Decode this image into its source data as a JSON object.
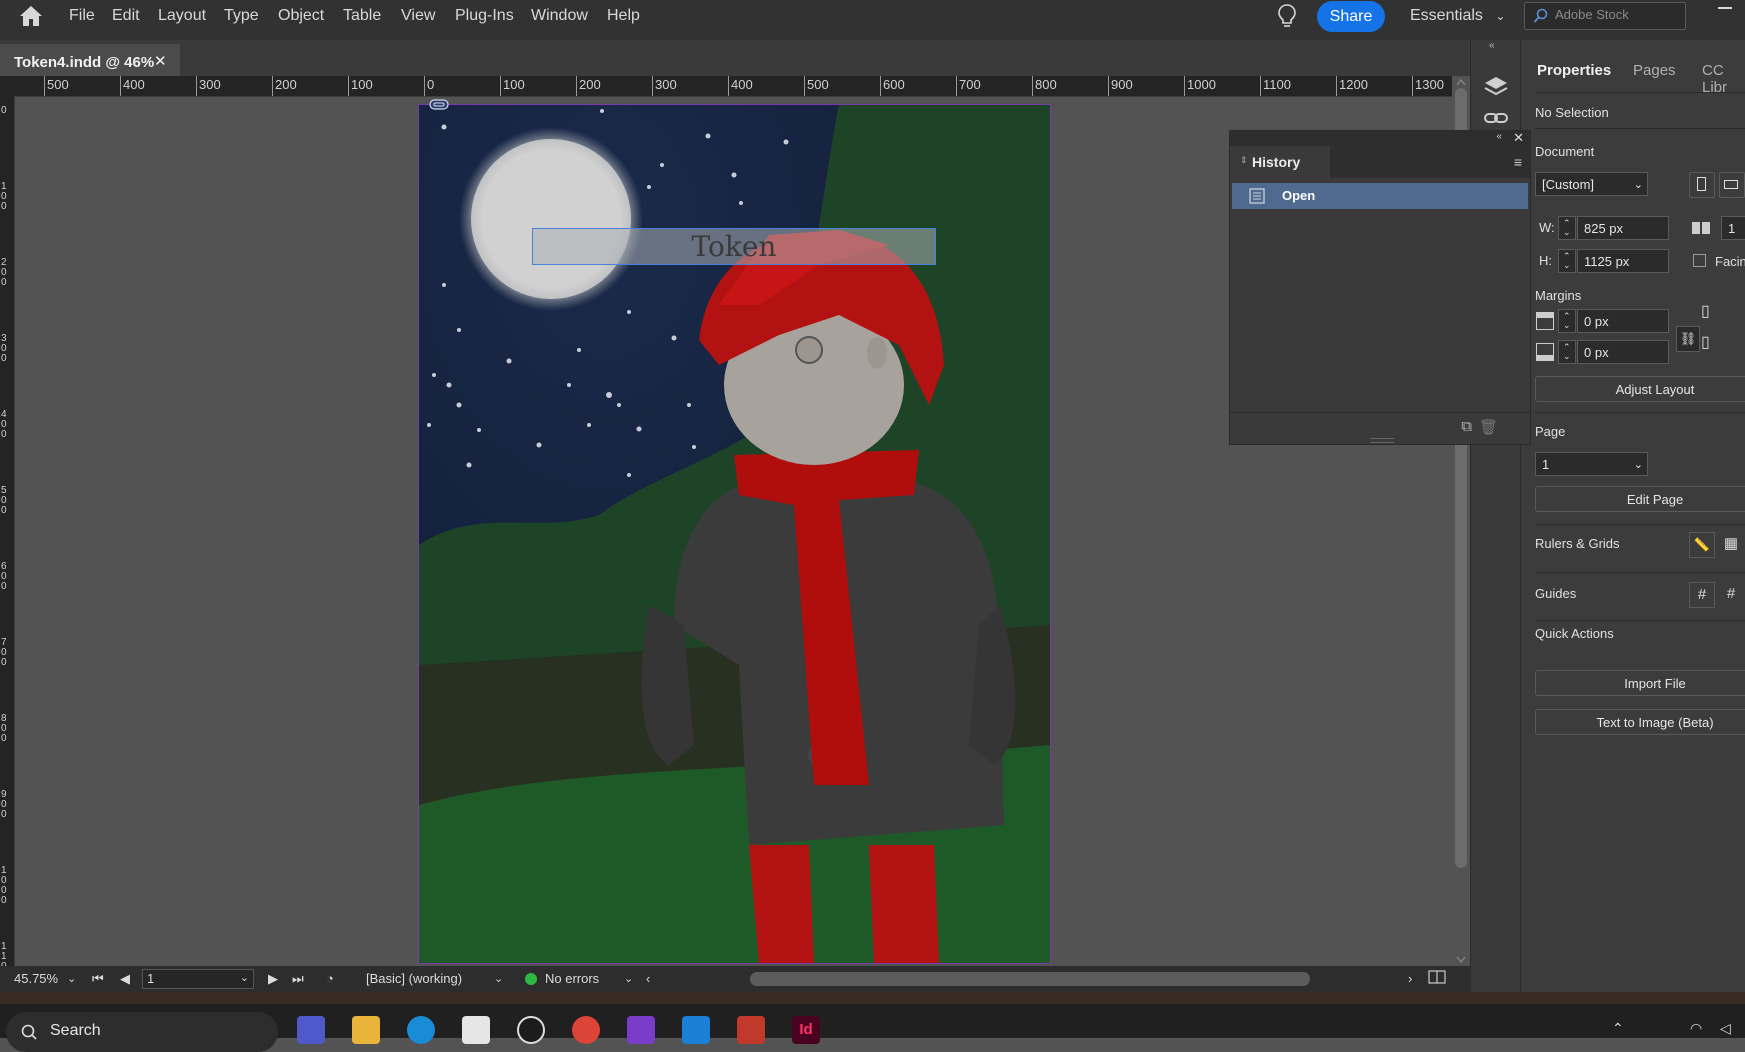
{
  "menubar": {
    "items": [
      "File",
      "Edit",
      "Layout",
      "Type",
      "Object",
      "Table",
      "View",
      "Plug-Ins",
      "Window",
      "Help"
    ],
    "share_label": "Share",
    "workspace_label": "Essentials",
    "stock_placeholder": "Adobe Stock"
  },
  "document_tab": {
    "label": "Token4.indd @ 46%",
    "close_glyph": "✕"
  },
  "ruler": {
    "horizontal_labels": [
      "500",
      "400",
      "300",
      "200",
      "100",
      "0",
      "100",
      "200",
      "300",
      "400",
      "500",
      "600",
      "700",
      "800",
      "900",
      "1000",
      "1100",
      "1200",
      "1300"
    ],
    "vertical_labels": [
      "0",
      "100",
      "200",
      "300",
      "400",
      "500",
      "600",
      "700",
      "800",
      "900",
      "1000",
      "1100"
    ]
  },
  "canvas": {
    "textframe_text": "Token"
  },
  "statusbar": {
    "zoom": "45.75%",
    "page": "1",
    "preflight_profile": "[Basic] (working)",
    "errors": "No errors"
  },
  "history": {
    "title": "History",
    "items": [
      "Open"
    ]
  },
  "properties": {
    "tabs": [
      "Properties",
      "Pages",
      "CC Libr"
    ],
    "selection": "No Selection",
    "document_heading": "Document",
    "preset": "[Custom]",
    "width_label": "W:",
    "width_value": "825 px",
    "height_label": "H:",
    "height_value": "1125 px",
    "pages_value": "1",
    "facing_label": "Facin",
    "margins_heading": "Margins",
    "margin_top": "0 px",
    "margin_bottom": "0 px",
    "adjust_layout": "Adjust Layout",
    "page_heading": "Page",
    "page_value": "1",
    "edit_page": "Edit Page",
    "rulers_grids": "Rulers & Grids",
    "guides": "Guides",
    "quick_actions": "Quick Actions",
    "import_file": "Import File",
    "text_to_image": "Text to Image (Beta)"
  },
  "taskbar": {
    "search_label": "Search"
  },
  "colors": {
    "accent_blue": "#1473e6",
    "selection_blue": "#4e6a8f",
    "ok_green": "#2db842",
    "page_border": "#7a3aa8"
  }
}
